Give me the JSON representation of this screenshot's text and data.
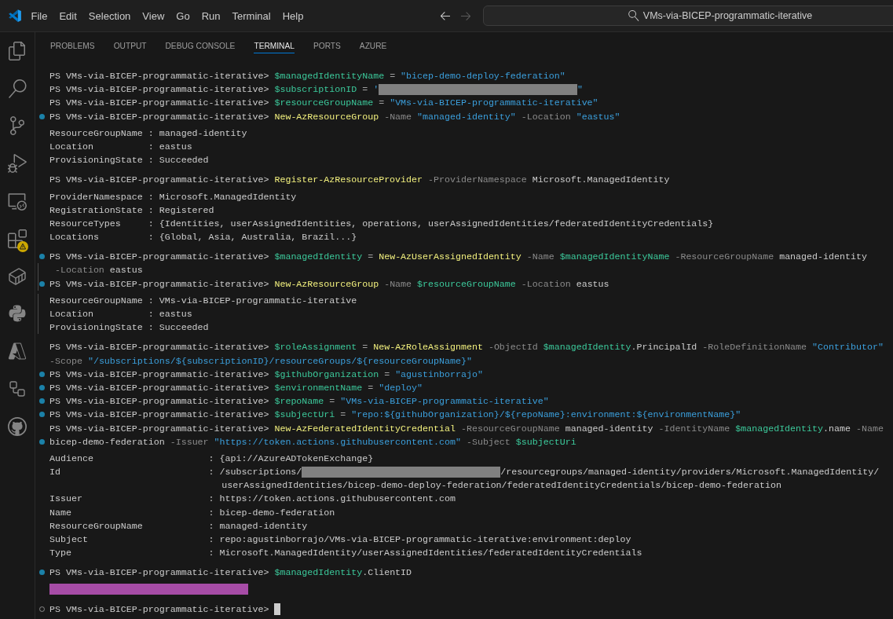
{
  "title_bar": {
    "menu": [
      "File",
      "Edit",
      "Selection",
      "View",
      "Go",
      "Run",
      "Terminal",
      "Help"
    ],
    "navigation": [
      {
        "kind": "back",
        "disabled": false
      },
      {
        "kind": "forward",
        "disabled": true
      }
    ],
    "command_center": {
      "label": "VMs-via-BICEP-programmatic-iterative"
    }
  },
  "activity_bar": [
    {
      "kind": "explorer",
      "selected": false,
      "warning": false
    },
    {
      "kind": "search",
      "selected": false,
      "warning": false
    },
    {
      "kind": "source_control",
      "selected": false,
      "warning": false
    },
    {
      "kind": "run_debug",
      "selected": false,
      "warning": false
    },
    {
      "kind": "remote_explorer",
      "selected": false,
      "warning": false
    },
    {
      "kind": "extensions",
      "selected": false,
      "warning": true
    },
    {
      "kind": "containers",
      "selected": false,
      "warning": false
    },
    {
      "kind": "python",
      "selected": false,
      "warning": false
    },
    {
      "kind": "azure",
      "selected": false,
      "warning": false
    },
    {
      "kind": "hierarchy",
      "selected": false,
      "warning": false
    },
    {
      "kind": "github",
      "selected": false,
      "warning": false
    }
  ],
  "panel": {
    "tabs": [
      {
        "label": "PROBLEMS",
        "selected": false
      },
      {
        "label": "OUTPUT",
        "selected": false
      },
      {
        "label": "DEBUG CONSOLE",
        "selected": false
      },
      {
        "label": "TERMINAL",
        "selected": true
      },
      {
        "label": "PORTS",
        "selected": false
      },
      {
        "label": "AZURE",
        "selected": false
      }
    ]
  },
  "terminal": {
    "cursor": true,
    "rows": [
      {
        "kind": "command",
        "bracket": false,
        "segments": [
          {
            "kind": "prompt",
            "text": "PS VMs-via-BICEP-programmatic-iterative> "
          },
          {
            "kind": "variable",
            "text": "$managedIdentityName"
          },
          {
            "kind": "operator",
            "text": " = "
          },
          {
            "kind": "string",
            "text": "\"bicep-demo-deploy-federation\""
          }
        ]
      },
      {
        "kind": "command",
        "bracket": false,
        "segments": [
          {
            "kind": "prompt",
            "text": "PS VMs-via-BICEP-programmatic-iterative> "
          },
          {
            "kind": "variable",
            "text": "$subscriptionID"
          },
          {
            "kind": "operator",
            "text": " = "
          },
          {
            "kind": "string",
            "text": "'"
          },
          {
            "kind": "redacted",
            "color": "#808080"
          },
          {
            "kind": "string",
            "text": "\""
          }
        ]
      },
      {
        "kind": "command",
        "bracket": false,
        "segments": [
          {
            "kind": "prompt",
            "text": "PS VMs-via-BICEP-programmatic-iterative> "
          },
          {
            "kind": "variable",
            "text": "$resourceGroupName"
          },
          {
            "kind": "operator",
            "text": " = "
          },
          {
            "kind": "string",
            "text": "\"VMs-via-BICEP-programmatic-iterative\""
          }
        ]
      },
      {
        "kind": "command",
        "marker": {
          "kind": "dot"
        },
        "bracket": false,
        "segments": [
          {
            "kind": "prompt",
            "text": "PS VMs-via-BICEP-programmatic-iterative> "
          },
          {
            "kind": "command",
            "text": "New-AzResourceGroup"
          },
          {
            "kind": "parameter",
            "text": " -Name "
          },
          {
            "kind": "string",
            "text": "\"managed-identity\""
          },
          {
            "kind": "parameter",
            "text": " -Location "
          },
          {
            "kind": "string",
            "text": "\"eastus\""
          }
        ]
      },
      {
        "kind": "output",
        "bracket": false,
        "segments": [
          {
            "kind": "plain",
            "text": "ResourceGroupName : managed-identity"
          }
        ]
      },
      {
        "kind": "output",
        "bracket": false,
        "segments": [
          {
            "kind": "plain",
            "text": "Location          : eastus"
          }
        ]
      },
      {
        "kind": "output",
        "bracket": false,
        "segments": [
          {
            "kind": "plain",
            "text": "ProvisioningState : Succeeded"
          }
        ]
      },
      {
        "kind": "command",
        "bracket": false,
        "segments": [
          {
            "kind": "prompt",
            "text": "PS VMs-via-BICEP-programmatic-iterative> "
          },
          {
            "kind": "command",
            "text": "Register-AzResourceProvider"
          },
          {
            "kind": "parameter",
            "text": " -ProviderNamespace "
          },
          {
            "kind": "plain",
            "text": "Microsoft.ManagedIdentity"
          }
        ]
      },
      {
        "kind": "output",
        "bracket": false,
        "segments": [
          {
            "kind": "plain",
            "text": "ProviderNamespace : Microsoft.ManagedIdentity"
          }
        ]
      },
      {
        "kind": "output",
        "bracket": false,
        "segments": [
          {
            "kind": "plain",
            "text": "RegistrationState : Registered"
          }
        ]
      },
      {
        "kind": "output",
        "bracket": false,
        "segments": [
          {
            "kind": "plain",
            "text": "ResourceTypes     : {Identities, userAssignedIdentities, operations, userAssignedIdentities/federatedIdentityCredentials}"
          }
        ]
      },
      {
        "kind": "output",
        "bracket": false,
        "segments": [
          {
            "kind": "plain",
            "text": "Locations         : {Global, Asia, Australia, Brazil...}"
          }
        ]
      },
      {
        "kind": "command",
        "marker": {
          "kind": "dot"
        },
        "bracket": false,
        "segments": [
          {
            "kind": "prompt",
            "text": "PS VMs-via-BICEP-programmatic-iterative> "
          },
          {
            "kind": "variable",
            "text": "$managedIdentity"
          },
          {
            "kind": "operator",
            "text": " = "
          },
          {
            "kind": "command",
            "text": "New-AzUserAssignedIdentity"
          },
          {
            "kind": "parameter",
            "text": " -Name "
          },
          {
            "kind": "variable",
            "text": "$managedIdentityName"
          },
          {
            "kind": "parameter",
            "text": " -ResourceGroupName "
          },
          {
            "kind": "plain",
            "text": "managed-identity"
          }
        ]
      },
      {
        "kind": "continuation",
        "bracket": true,
        "segments": [
          {
            "kind": "parameter",
            "text": " -Location "
          },
          {
            "kind": "plain",
            "text": "eastus"
          }
        ]
      },
      {
        "kind": "command",
        "marker": {
          "kind": "dot"
        },
        "bracket": true,
        "segments": [
          {
            "kind": "prompt",
            "text": "PS VMs-via-BICEP-programmatic-iterative> "
          },
          {
            "kind": "command",
            "text": "New-AzResourceGroup"
          },
          {
            "kind": "parameter",
            "text": " -Name "
          },
          {
            "kind": "variable",
            "text": "$resourceGroupName"
          },
          {
            "kind": "parameter",
            "text": " -Location "
          },
          {
            "kind": "plain",
            "text": "eastus"
          }
        ]
      },
      {
        "kind": "output",
        "bracket": true,
        "segments": [
          {
            "kind": "plain",
            "text": "ResourceGroupName : VMs-via-BICEP-programmatic-iterative"
          }
        ]
      },
      {
        "kind": "output",
        "bracket": true,
        "segments": [
          {
            "kind": "plain",
            "text": "Location          : eastus"
          }
        ]
      },
      {
        "kind": "output",
        "bracket": true,
        "segments": [
          {
            "kind": "plain",
            "text": "ProvisioningState : Succeeded"
          }
        ]
      },
      {
        "kind": "command",
        "bracket": false,
        "segments": [
          {
            "kind": "prompt",
            "text": "PS VMs-via-BICEP-programmatic-iterative> "
          },
          {
            "kind": "variable",
            "text": "$roleAssignment"
          },
          {
            "kind": "operator",
            "text": " = "
          },
          {
            "kind": "command",
            "text": "New-AzRoleAssignment"
          },
          {
            "kind": "parameter",
            "text": " -ObjectId "
          },
          {
            "kind": "variable",
            "text": "$managedIdentity"
          },
          {
            "kind": "plain",
            "text": ".PrincipalId"
          },
          {
            "kind": "parameter",
            "text": " -RoleDefinitionName "
          },
          {
            "kind": "string",
            "text": "\"Contributor\""
          }
        ]
      },
      {
        "kind": "continuation",
        "bracket": false,
        "segments": [
          {
            "kind": "parameter",
            "text": "-Scope "
          },
          {
            "kind": "string",
            "text": "\"/subscriptions/${subscriptionID}/resourceGroups/${resourceGroupName}\""
          }
        ]
      },
      {
        "kind": "command",
        "marker": {
          "kind": "dot"
        },
        "bracket": false,
        "segments": [
          {
            "kind": "prompt",
            "text": "PS VMs-via-BICEP-programmatic-iterative> "
          },
          {
            "kind": "variable",
            "text": "$githubOrganization"
          },
          {
            "kind": "operator",
            "text": " = "
          },
          {
            "kind": "string",
            "text": "\"agustinborrajo\""
          }
        ]
      },
      {
        "kind": "command",
        "marker": {
          "kind": "dot"
        },
        "bracket": false,
        "segments": [
          {
            "kind": "prompt",
            "text": "PS VMs-via-BICEP-programmatic-iterative> "
          },
          {
            "kind": "variable",
            "text": "$environmentName"
          },
          {
            "kind": "operator",
            "text": " = "
          },
          {
            "kind": "string",
            "text": "\"deploy\""
          }
        ]
      },
      {
        "kind": "command",
        "marker": {
          "kind": "dot"
        },
        "bracket": false,
        "segments": [
          {
            "kind": "prompt",
            "text": "PS VMs-via-BICEP-programmatic-iterative> "
          },
          {
            "kind": "variable",
            "text": "$repoName"
          },
          {
            "kind": "operator",
            "text": " = "
          },
          {
            "kind": "string",
            "text": "\"VMs-via-BICEP-programmatic-iterative\""
          }
        ]
      },
      {
        "kind": "command",
        "marker": {
          "kind": "dot"
        },
        "bracket": false,
        "segments": [
          {
            "kind": "prompt",
            "text": "PS VMs-via-BICEP-programmatic-iterative> "
          },
          {
            "kind": "variable",
            "text": "$subjectUri"
          },
          {
            "kind": "operator",
            "text": " = "
          },
          {
            "kind": "string",
            "text": "\"repo:${githubOrganization}/${repoName}:environment:${environmentName}\""
          }
        ]
      },
      {
        "kind": "command",
        "bracket": false,
        "segments": [
          {
            "kind": "prompt",
            "text": "PS VMs-via-BICEP-programmatic-iterative> "
          },
          {
            "kind": "command",
            "text": "New-AzFederatedIdentityCredential"
          },
          {
            "kind": "parameter",
            "text": " -ResourceGroupName "
          },
          {
            "kind": "plain",
            "text": "managed-identity"
          },
          {
            "kind": "parameter",
            "text": " -IdentityName "
          },
          {
            "kind": "variable",
            "text": "$managedIdentity"
          },
          {
            "kind": "plain",
            "text": ".name"
          },
          {
            "kind": "parameter",
            "text": " -Name"
          }
        ]
      },
      {
        "kind": "continuation",
        "marker": {
          "kind": "dot"
        },
        "bracket": false,
        "segments": [
          {
            "kind": "plain",
            "text": "bicep-demo-federation"
          },
          {
            "kind": "parameter",
            "text": " -Issuer "
          },
          {
            "kind": "string",
            "text": "\"https://token.actions.githubusercontent.com\""
          },
          {
            "kind": "parameter",
            "text": " -Subject "
          },
          {
            "kind": "variable",
            "text": "$subjectUri"
          }
        ]
      },
      {
        "kind": "output",
        "bracket": false,
        "segments": [
          {
            "kind": "plain",
            "text": "Audience                     : {api://AzureADTokenExchange}"
          }
        ]
      },
      {
        "kind": "output",
        "bracket": false,
        "segments": [
          {
            "kind": "plain",
            "text": "Id                           : /subscriptions/"
          },
          {
            "kind": "redacted",
            "color": "#808080"
          },
          {
            "kind": "plain",
            "text": "/resourcegroups/managed-identity/providers/Microsoft.ManagedIdentity/"
          }
        ]
      },
      {
        "kind": "output_wrap",
        "bracket": false,
        "segments": [
          {
            "kind": "plain",
            "text": "userAssignedIdentities/bicep-demo-deploy-federation/federatedIdentityCredentials/bicep-demo-federation"
          }
        ]
      },
      {
        "kind": "output",
        "bracket": false,
        "segments": [
          {
            "kind": "plain",
            "text": "Issuer                       : https://token.actions.githubusercontent.com"
          }
        ]
      },
      {
        "kind": "output",
        "bracket": false,
        "segments": [
          {
            "kind": "plain",
            "text": "Name                         : bicep-demo-federation"
          }
        ]
      },
      {
        "kind": "output",
        "bracket": false,
        "segments": [
          {
            "kind": "plain",
            "text": "ResourceGroupName            : managed-identity"
          }
        ]
      },
      {
        "kind": "output",
        "bracket": false,
        "segments": [
          {
            "kind": "plain",
            "text": "Subject                      : repo:agustinborrajo/VMs-via-BICEP-programmatic-iterative:environment:deploy"
          }
        ]
      },
      {
        "kind": "output",
        "bracket": false,
        "segments": [
          {
            "kind": "plain",
            "text": "Type                         : Microsoft.ManagedIdentity/userAssignedIdentities/federatedIdentityCredentials"
          }
        ]
      },
      {
        "kind": "command",
        "marker": {
          "kind": "dot"
        },
        "bracket": false,
        "segments": [
          {
            "kind": "prompt",
            "text": "PS VMs-via-BICEP-programmatic-iterative> "
          },
          {
            "kind": "variable",
            "text": "$managedIdentity"
          },
          {
            "kind": "plain",
            "text": ".ClientID"
          }
        ]
      },
      {
        "kind": "output",
        "bracket": false,
        "segments": [
          {
            "kind": "redacted",
            "color": "#a64ca6"
          }
        ]
      },
      {
        "kind": "command",
        "marker": {
          "kind": "ring"
        },
        "bracket": false,
        "segments": [
          {
            "kind": "prompt",
            "text": "PS VMs-via-BICEP-programmatic-iterative> "
          }
        ]
      }
    ]
  }
}
